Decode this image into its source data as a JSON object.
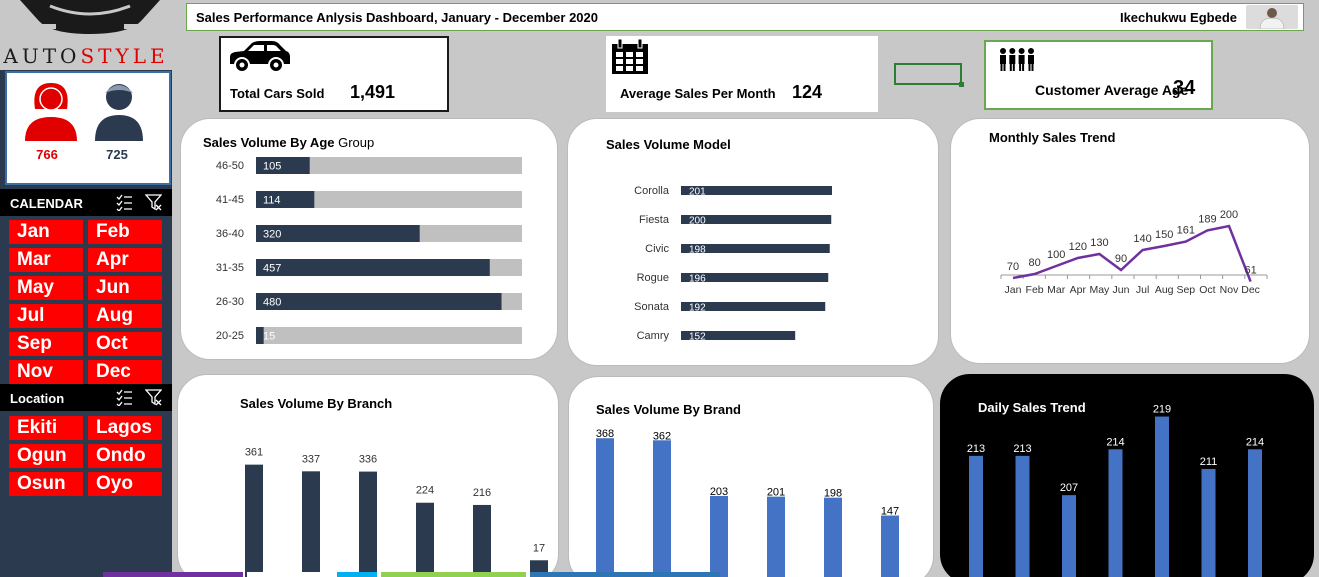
{
  "logo": {
    "text_a": "AUTO",
    "text_b": "STYLE"
  },
  "gender": {
    "female_value": "766",
    "male_value": "725",
    "female_color": "#e00000",
    "male_color": "#2b3a4f"
  },
  "calendar": {
    "title": "CALENDAR",
    "months": [
      "Jan",
      "Feb",
      "Mar",
      "Apr",
      "May",
      "Jun",
      "Jul",
      "Aug",
      "Sep",
      "Oct",
      "Nov",
      "Dec"
    ]
  },
  "location": {
    "title": "Location",
    "items": [
      "Ekiti",
      "Lagos",
      "Ogun",
      "Ondo",
      "Osun",
      "Oyo"
    ]
  },
  "header": {
    "title": "Sales Performance Anlysis Dashboard, January - December 2020",
    "author": "Ikechukwu Egbede"
  },
  "kpis": {
    "cars_label": "Total Cars Sold",
    "cars_value": "1,491",
    "avg_label": "Average Sales Per Month",
    "avg_value": "124",
    "age_label": "Customer Average Age",
    "age_value": "34"
  },
  "colors": {
    "navy": "#2b3a4f",
    "track": "#c0c0c0",
    "blue": "#4472c4",
    "purple": "#7030a0",
    "slicer_red": "#ff0000",
    "sidebar": "#2b3a4f"
  },
  "chart_data": [
    {
      "id": "age",
      "type": "bar",
      "orientation": "horizontal",
      "title_bold": "Sales Volume By Age",
      "title_normal": " Group",
      "categories": [
        "46-50",
        "41-45",
        "36-40",
        "31-35",
        "26-30",
        "20-25"
      ],
      "values": [
        105,
        114,
        320,
        457,
        480,
        15
      ],
      "xlim": [
        0,
        520
      ]
    },
    {
      "id": "model",
      "type": "bar",
      "orientation": "horizontal",
      "title": "Sales Volume Model",
      "categories": [
        "Corolla",
        "Fiesta",
        "Civic",
        "Rogue",
        "Sonata",
        "Camry"
      ],
      "values": [
        201,
        200,
        198,
        196,
        192,
        152
      ],
      "xlim": [
        0,
        201
      ]
    },
    {
      "id": "trend",
      "type": "line",
      "title": "Monthly Sales Trend",
      "categories": [
        "Jan",
        "Feb",
        "Mar",
        "Apr",
        "May",
        "Jun",
        "Jul",
        "Aug",
        "Sep",
        "Oct",
        "Nov",
        "Dec"
      ],
      "values": [
        70,
        80,
        100,
        120,
        130,
        90,
        140,
        150,
        161,
        189,
        200,
        61
      ]
    },
    {
      "id": "branch",
      "type": "bar",
      "title": "Sales Volume By Branch",
      "values": [
        361,
        337,
        336,
        224,
        216,
        17
      ]
    },
    {
      "id": "brand",
      "type": "bar",
      "title": "Sales Volume By Brand",
      "values": [
        368,
        362,
        203,
        201,
        198,
        147
      ]
    },
    {
      "id": "daily",
      "type": "bar",
      "title": "Daily Sales Trend",
      "values": [
        213,
        213,
        207,
        214,
        219,
        211,
        214
      ],
      "ylim": [
        200,
        220
      ]
    }
  ]
}
